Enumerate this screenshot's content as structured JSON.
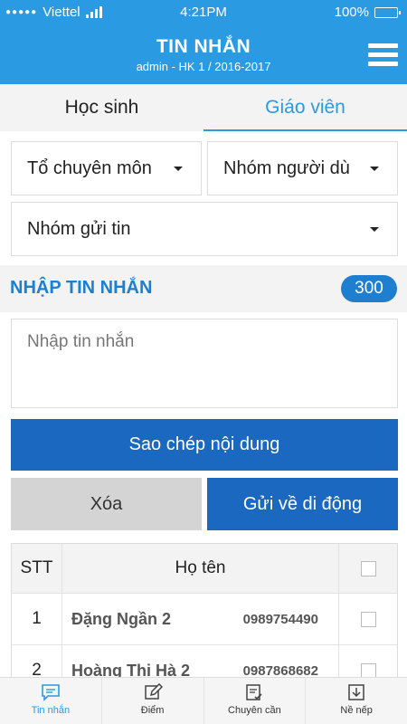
{
  "status_bar": {
    "carrier": "Viettel",
    "time": "4:21PM",
    "battery": "100%"
  },
  "header": {
    "title": "TIN NHẮN",
    "subtitle": "admin - HK 1 / 2016-2017"
  },
  "tabs": [
    {
      "label": "Học sinh",
      "active": false
    },
    {
      "label": "Giáo viên",
      "active": true
    }
  ],
  "filters": {
    "department": "Tổ chuyên môn",
    "user_group": "Nhóm người dù",
    "send_group": "Nhóm gửi tin"
  },
  "compose": {
    "section_title": "NHẬP TIN NHẮN",
    "char_count": "300",
    "placeholder": "Nhập tin nhắn"
  },
  "buttons": {
    "copy": "Sao chép nội dung",
    "delete": "Xóa",
    "send": "Gửi về di động"
  },
  "table": {
    "headers": {
      "stt": "STT",
      "name": "Họ tên"
    },
    "rows": [
      {
        "stt": "1",
        "name": "Đặng Ngần 2",
        "phone": "0989754490"
      },
      {
        "stt": "2",
        "name": "Hoàng Thị Hà 2",
        "phone": "0987868682"
      }
    ]
  },
  "bottom_nav": [
    {
      "label": "Tin nhắn",
      "icon": "message-icon",
      "active": true
    },
    {
      "label": "Điểm",
      "icon": "edit-icon",
      "active": false
    },
    {
      "label": "Chuyên cần",
      "icon": "attendance-icon",
      "active": false
    },
    {
      "label": "Nề nếp",
      "icon": "discipline-icon",
      "active": false
    }
  ],
  "colors": {
    "primary": "#2a9ae3",
    "button_blue": "#1a68c0",
    "button_gray": "#d4d4d4"
  }
}
